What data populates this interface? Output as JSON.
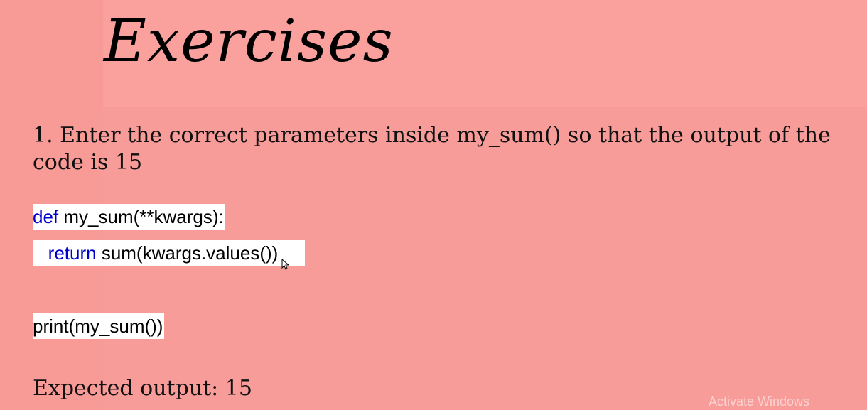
{
  "slide": {
    "title": "Exercises",
    "question": "1. Enter the correct parameters inside my_sum() so that the output of the code is 15",
    "code": {
      "line1_keyword": "def",
      "line1_rest": " my_sum(**kwargs):",
      "line2_keyword": "return",
      "line2_rest": " sum(kwargs.values())",
      "line3": "print(my_sum())"
    },
    "expected_output": "Expected output: 15"
  },
  "watermark": "Activate Windows",
  "colors": {
    "background": "#F79C99",
    "keyword": "#0000CC",
    "code_background": "#FFFFFF"
  }
}
